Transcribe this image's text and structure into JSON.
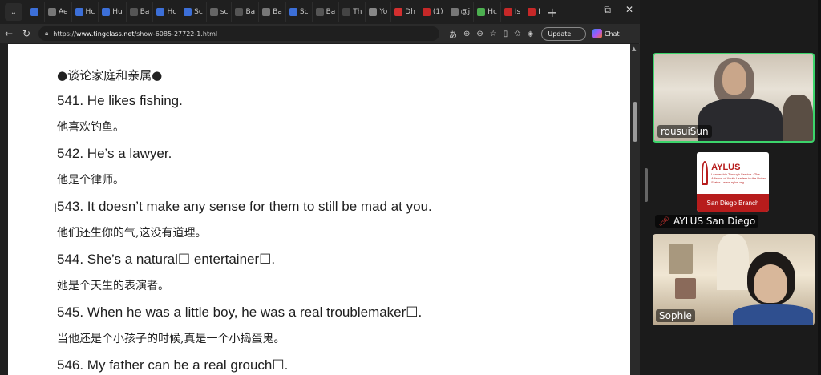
{
  "browser": {
    "tabs": [
      {
        "label": "",
        "color": "#3c6fd8"
      },
      {
        "label": "Ae",
        "color": "#777777"
      },
      {
        "label": "Hc",
        "color": "#3c6fd8"
      },
      {
        "label": "Hu",
        "color": "#3c6fd8"
      },
      {
        "label": "Ba",
        "color": "#555555"
      },
      {
        "label": "Hc",
        "color": "#3c6fd8"
      },
      {
        "label": "Sc",
        "color": "#3c6fd8"
      },
      {
        "label": "sc",
        "color": "#666666"
      },
      {
        "label": "Ba",
        "color": "#555555"
      },
      {
        "label": "Ba",
        "color": "#777777"
      },
      {
        "label": "Sc",
        "color": "#3c6fd8"
      },
      {
        "label": "Ba",
        "color": "#555555"
      },
      {
        "label": "Th",
        "color": "#444444"
      },
      {
        "label": "Yo",
        "color": "#888888"
      },
      {
        "label": "Dh",
        "color": "#d32f2f"
      },
      {
        "label": "(1)",
        "color": "#c62828"
      },
      {
        "label": "@j",
        "color": "#777777"
      },
      {
        "label": "Hc",
        "color": "#4caf50"
      },
      {
        "label": "Is",
        "color": "#c62828"
      },
      {
        "label": "Inl",
        "color": "#c62828"
      },
      {
        "label": "Sig",
        "color": "#4285f4"
      },
      {
        "label": "Ne",
        "color": "#555555"
      },
      {
        "label": "",
        "color": "#f57c00",
        "active": true
      }
    ],
    "new_tab_glyph": "+",
    "window_controls": [
      "—",
      "⧉",
      "✕"
    ],
    "url_scheme": "https://",
    "url_host": "www.tingclass.net",
    "url_path": "/show-6085-27722-1.html",
    "update_label": "Update",
    "chat_label": "Chat"
  },
  "page": {
    "heading": "●谈论家庭和亲属●",
    "lines": [
      {
        "en": "541. He likes fishing.",
        "zh": "他喜欢钓鱼。"
      },
      {
        "en": "542. He’s a lawyer.",
        "zh": "他是个律师。"
      },
      {
        "en": "543. It doesn’t make any sense for them to still be mad at you.",
        "zh": "他们还生你的气,这没有道理。"
      },
      {
        "en": "544. She’s a natural☐ entertainer☐.",
        "zh": "她是个天生的表演者。"
      },
      {
        "en": "545. When he was a little boy, he was a real troublemaker☐.",
        "zh": "当他还是个小孩子的时候,真是一个小捣蛋鬼。"
      },
      {
        "en": "546. My father can be a real grouch☐.",
        "zh": ""
      }
    ]
  },
  "participants": {
    "p1_name": "rousuiSun",
    "p2_name": "AYLUS San Diego",
    "p2_logo_title": "AYLUS",
    "p2_logo_band": "San Diego Branch",
    "p2_logo_small": "Leadership Through Service · The Alliance of Youth Leaders in the United States · www.aylus.org",
    "p3_name": "Sophie"
  }
}
